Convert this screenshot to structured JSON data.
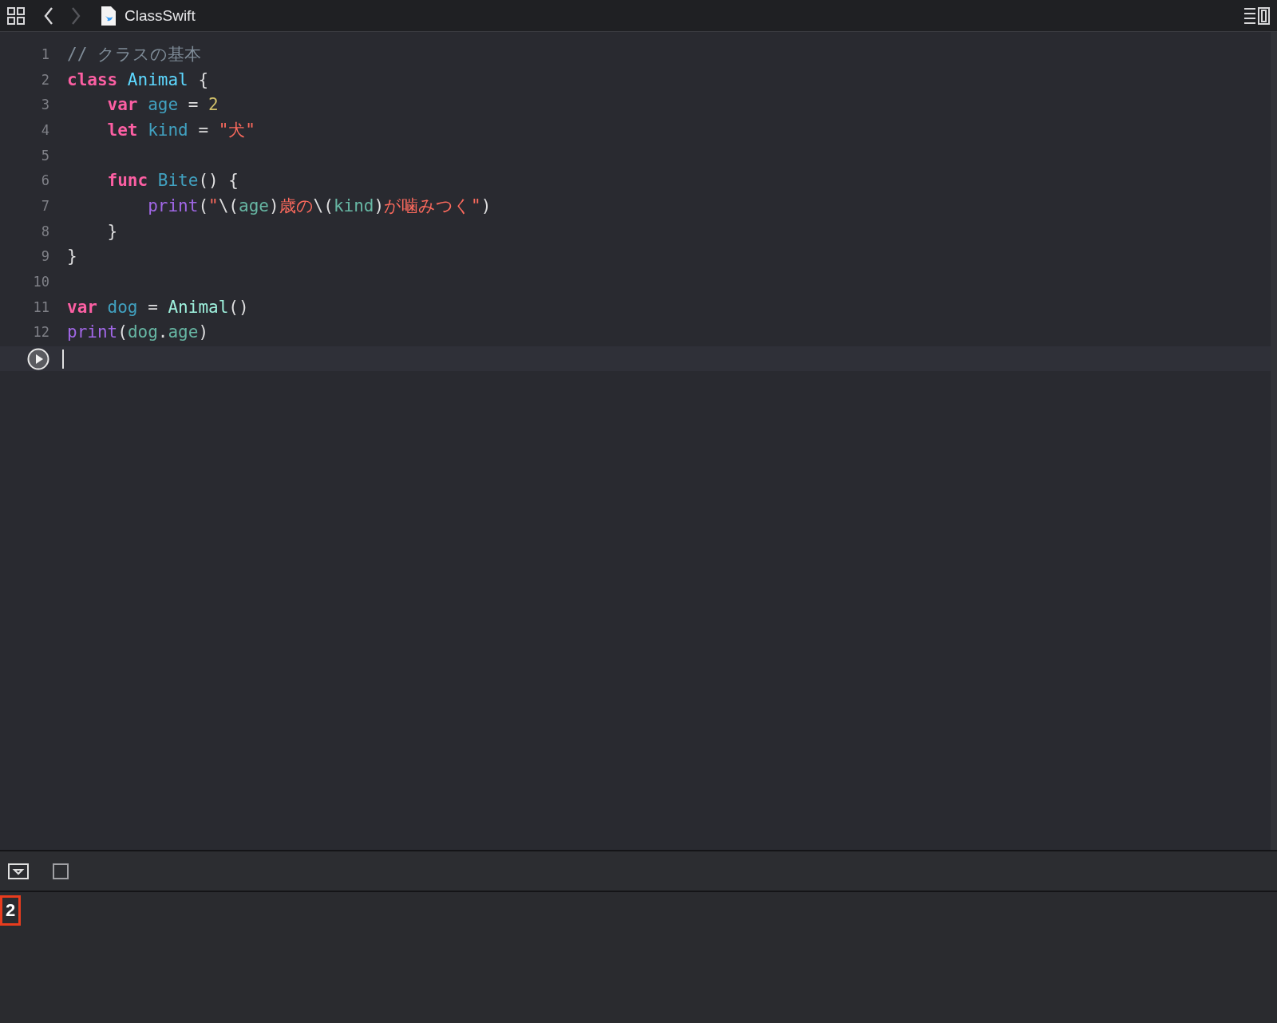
{
  "toolbar": {
    "nav": [
      {
        "kind": "back",
        "disabled": false
      },
      {
        "kind": "forward",
        "disabled": true
      }
    ],
    "file_name": "ClassSwift"
  },
  "editor": {
    "lines": [
      {
        "number": "1",
        "tokens": [
          {
            "kind": "comment",
            "text": "// クラスの基本"
          }
        ]
      },
      {
        "number": "2",
        "tokens": [
          {
            "kind": "keyword",
            "text": "class"
          },
          {
            "kind": "type_decl",
            "text": " Animal"
          },
          {
            "kind": "plain",
            "text": " {"
          }
        ]
      },
      {
        "number": "3",
        "tokens": [
          {
            "kind": "keyword",
            "text": "    var"
          },
          {
            "kind": "decl",
            "text": " age"
          },
          {
            "kind": "plain",
            "text": " = "
          },
          {
            "kind": "number",
            "text": "2"
          }
        ]
      },
      {
        "number": "4",
        "tokens": [
          {
            "kind": "keyword",
            "text": "    let"
          },
          {
            "kind": "decl",
            "text": " kind"
          },
          {
            "kind": "plain",
            "text": " = "
          },
          {
            "kind": "string",
            "text": "\"犬\""
          }
        ]
      },
      {
        "number": "5"
      },
      {
        "number": "6",
        "tokens": [
          {
            "kind": "keyword",
            "text": "    func"
          },
          {
            "kind": "decl",
            "text": " Bite"
          },
          {
            "kind": "plain",
            "text": "() {"
          }
        ]
      },
      {
        "number": "7",
        "tokens": [
          {
            "kind": "call",
            "text": "        print"
          },
          {
            "kind": "plain",
            "text": "("
          },
          {
            "kind": "string",
            "text": "\""
          },
          {
            "kind": "plain",
            "text": "\\("
          },
          {
            "kind": "ref",
            "text": "age"
          },
          {
            "kind": "plain",
            "text": ")"
          },
          {
            "kind": "string",
            "text": "歳の"
          },
          {
            "kind": "plain",
            "text": "\\("
          },
          {
            "kind": "ref",
            "text": "kind"
          },
          {
            "kind": "plain",
            "text": ")"
          },
          {
            "kind": "string",
            "text": "が噛みつく\""
          },
          {
            "kind": "plain",
            "text": ")"
          }
        ]
      },
      {
        "number": "8",
        "tokens": [
          {
            "kind": "plain",
            "text": "    }"
          }
        ]
      },
      {
        "number": "9",
        "tokens": [
          {
            "kind": "plain",
            "text": "}"
          }
        ]
      },
      {
        "number": "10"
      },
      {
        "number": "11",
        "tokens": [
          {
            "kind": "keyword",
            "text": "var"
          },
          {
            "kind": "decl",
            "text": " dog"
          },
          {
            "kind": "plain",
            "text": " = "
          },
          {
            "kind": "type_ref",
            "text": "Animal"
          },
          {
            "kind": "plain",
            "text": "()"
          }
        ]
      },
      {
        "number": "12",
        "tokens": [
          {
            "kind": "call",
            "text": "print"
          },
          {
            "kind": "plain",
            "text": "("
          },
          {
            "kind": "ref",
            "text": "dog"
          },
          {
            "kind": "plain",
            "text": "."
          },
          {
            "kind": "ref",
            "text": "age"
          },
          {
            "kind": "plain",
            "text": ")"
          }
        ]
      }
    ]
  },
  "console": {
    "output": "2",
    "highlighted": true
  }
}
